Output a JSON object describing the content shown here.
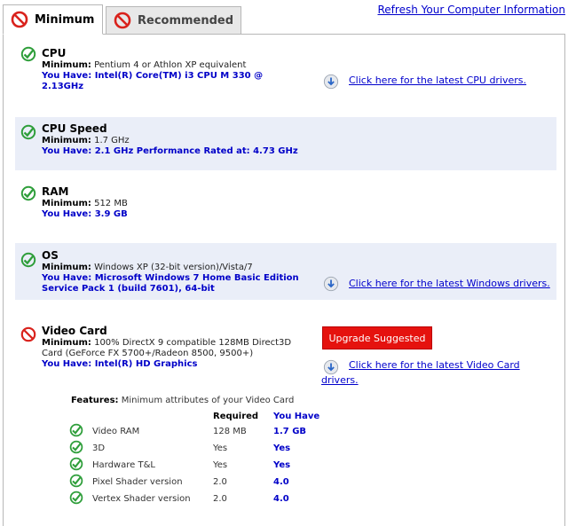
{
  "tabs": [
    {
      "label": "Minimum",
      "active": true
    },
    {
      "label": "Recommended",
      "active": false
    }
  ],
  "refresh_link": "Refresh Your Computer Information",
  "rows": {
    "cpu": {
      "title": "CPU",
      "min_label": "Minimum:",
      "min": "Pentium 4 or Athlon XP equivalent",
      "have_line1": "You Have: Intel(R) Core(TM) i3 CPU M 330 @",
      "have_line2": "2.13GHz",
      "link": "Click here for the latest CPU drivers.",
      "status": "pass"
    },
    "cpu_speed": {
      "title": "CPU Speed",
      "min_label": "Minimum:",
      "min": "1.7 GHz",
      "have": "You Have: 2.1 GHz Performance Rated at: 4.73 GHz",
      "status": "pass"
    },
    "ram": {
      "title": "RAM",
      "min_label": "Minimum:",
      "min": "512 MB",
      "have": "You Have: 3.9 GB",
      "status": "pass"
    },
    "os": {
      "title": "OS",
      "min_label": "Minimum:",
      "min": "Windows XP (32-bit version)/Vista/7",
      "have_line1": "You Have: Microsoft Windows 7 Home Basic Edition",
      "have_line2": "Service Pack 1 (build 7601), 64-bit",
      "link": "Click here for the latest Windows drivers.",
      "status": "pass"
    },
    "video": {
      "title": "Video Card",
      "min_label": "Minimum:",
      "min_line1": "100% DirectX 9 compatible 128MB Direct3D",
      "min_line2": "Card (GeForce FX 5700+/Radeon 8500, 9500+)",
      "have": "You Have: Intel(R) HD Graphics",
      "button": "Upgrade Suggested",
      "link_line1": "Click here for the latest Video Card",
      "link_line2": "drivers.",
      "status": "fail"
    }
  },
  "features": {
    "label_bold": "Features:",
    "label_rest": "Minimum attributes of your Video Card",
    "col_required": "Required",
    "col_have": "You Have",
    "items": [
      {
        "name": "Video RAM",
        "required": "128 MB",
        "have": "1.7 GB"
      },
      {
        "name": "3D",
        "required": "Yes",
        "have": "Yes"
      },
      {
        "name": "Hardware T&L",
        "required": "Yes",
        "have": "Yes"
      },
      {
        "name": "Pixel Shader version",
        "required": "2.0",
        "have": "4.0"
      },
      {
        "name": "Vertex Shader version",
        "required": "2.0",
        "have": "4.0"
      }
    ]
  },
  "colors": {
    "pass": "#2e9e3a",
    "fail": "#d9221c",
    "link": "#0000cc",
    "have": "#0000c8",
    "shade": "#eaeef8",
    "button": "#e5120e"
  },
  "icons": {
    "pass": "check-circle-icon",
    "fail": "no-entry-icon",
    "download": "download-disc-icon"
  }
}
